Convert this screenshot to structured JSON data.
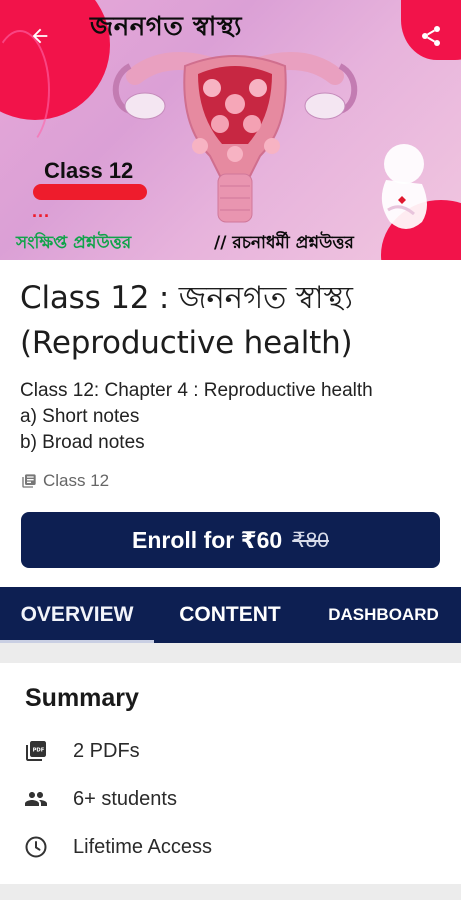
{
  "banner": {
    "heading": "জননগত স্বাস্থ্য",
    "class_label": "Class 12",
    "dots": "...",
    "sub_left": "সংক্ষিপ্ত প্রশ্নউত্তর",
    "sub_right": "// রচনাধর্মী প্রশ্নউত্তর",
    "colors": {
      "accent_red": "#f2134a",
      "background": "#e8a9d8",
      "green": "#11a34a"
    }
  },
  "header": {
    "back_icon": "arrow-left-icon",
    "share_icon": "share-icon"
  },
  "course": {
    "title": "Class 12 : জননগত স্বাস্থ্য (Reproductive health)",
    "description": [
      "Class 12: Chapter 4 : Reproductive health",
      "a) Short notes",
      "b) Broad notes"
    ],
    "class_tag": "Class 12",
    "class_tag_icon": "library-books-icon"
  },
  "enroll": {
    "label": "Enroll for ₹60",
    "original_price": "₹80",
    "color": "#0d1f52"
  },
  "tabs": [
    {
      "label": "OVERVIEW",
      "active": true
    },
    {
      "label": "CONTENT",
      "active": false
    },
    {
      "label": "DASHBOARD",
      "active": false
    }
  ],
  "summary": {
    "title": "Summary",
    "items": [
      {
        "icon": "pdf-icon",
        "text": "2 PDFs"
      },
      {
        "icon": "people-icon",
        "text": "6+ students"
      },
      {
        "icon": "clock-icon",
        "text": "Lifetime Access"
      }
    ]
  }
}
